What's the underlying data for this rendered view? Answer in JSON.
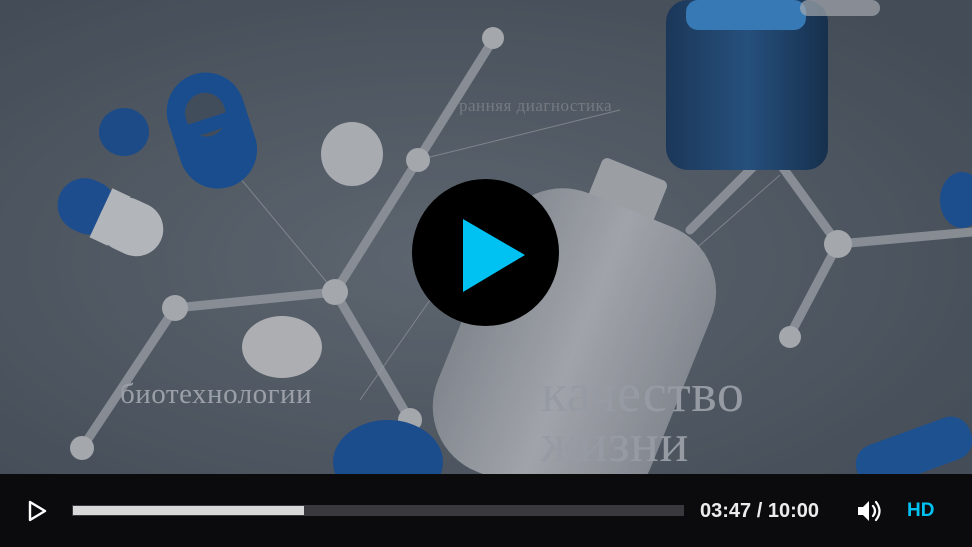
{
  "video": {
    "overlay_text": {
      "diagnostics": "ранняя диагностика",
      "biotech": "биотехнологии",
      "quality_line1": "качество",
      "quality_line2": "жизни"
    }
  },
  "player": {
    "accent_color": "#00c2f2",
    "progress_fraction": 0.378,
    "current_time": "03:47",
    "time_separator": "/",
    "duration": "10:00",
    "quality_label": "HD",
    "icons": {
      "big_play": "play-icon",
      "control_play": "play-icon",
      "volume": "volume-icon"
    }
  }
}
